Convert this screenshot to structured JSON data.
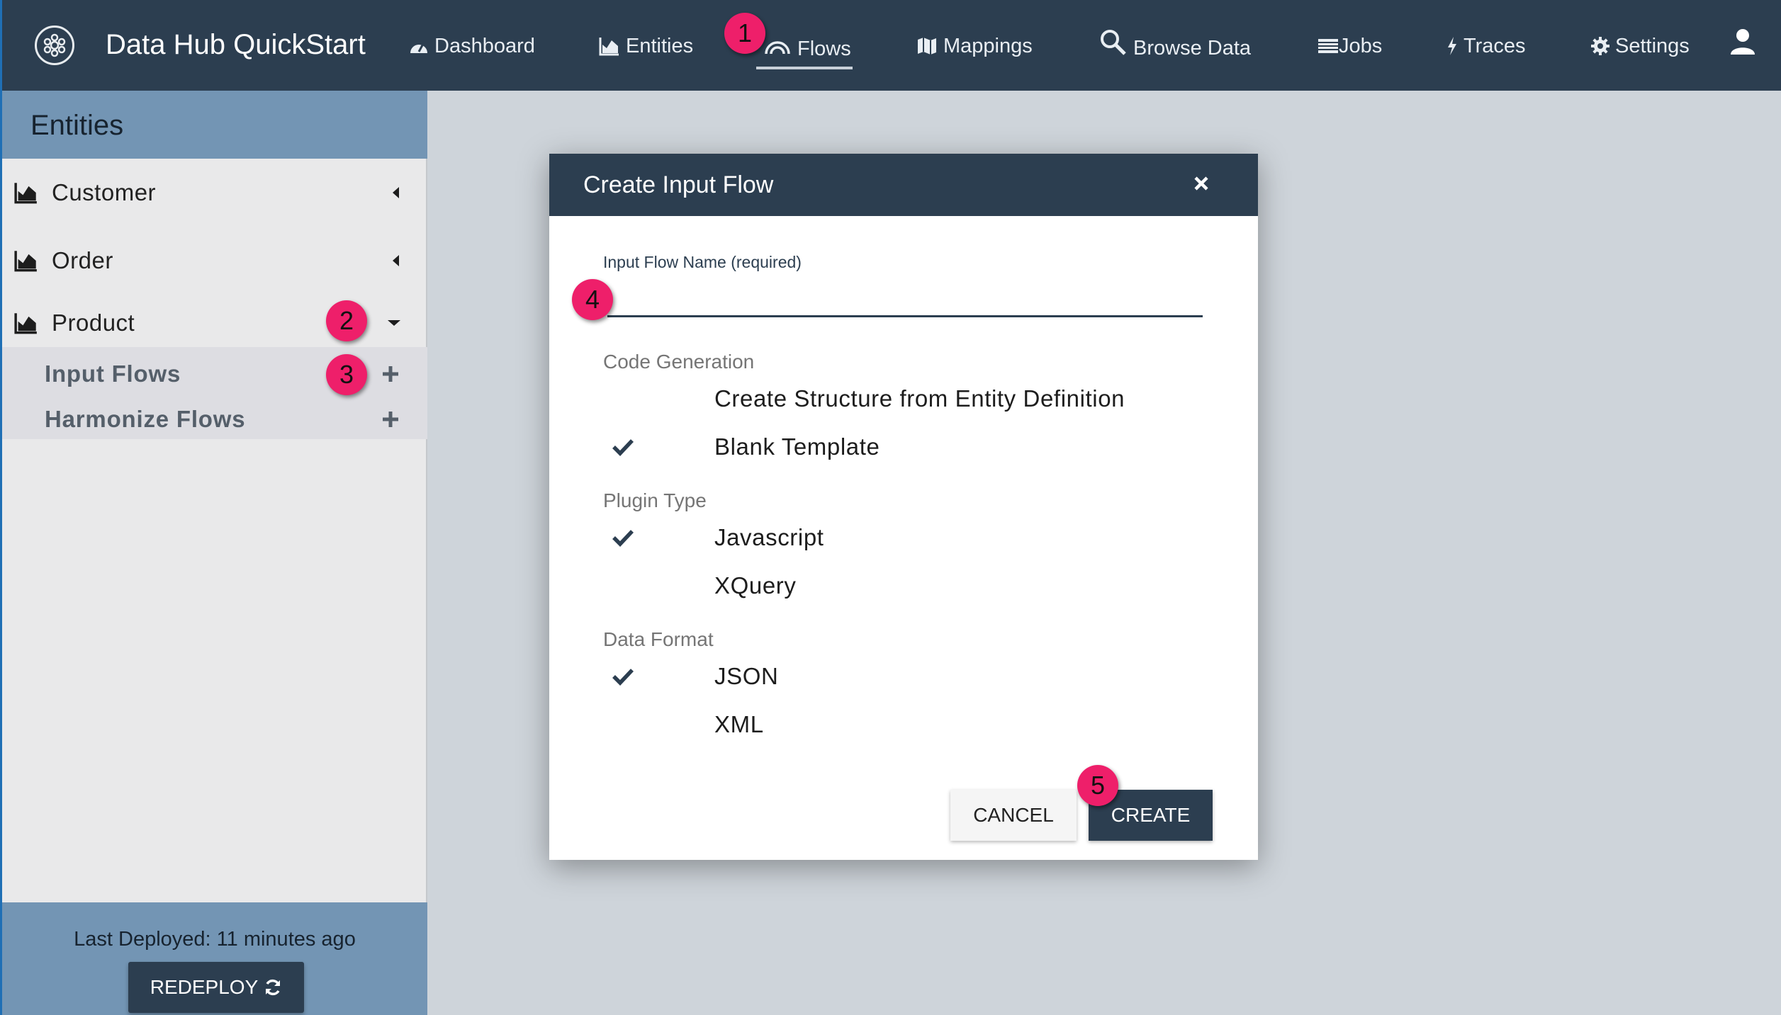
{
  "app": {
    "title": "Data Hub QuickStart",
    "accent_color": "#2c3e50",
    "sidebar_color": "#7395b4",
    "marker_color": "#ee1f6a"
  },
  "nav": {
    "items": [
      {
        "label": "Dashboard",
        "icon": "dashboard-icon"
      },
      {
        "label": "Entities",
        "icon": "area-chart-icon"
      },
      {
        "label": "Flows",
        "icon": "flows-arc-icon",
        "active": true
      },
      {
        "label": "Mappings",
        "icon": "map-icon"
      },
      {
        "label": "Browse Data",
        "icon": "search-icon"
      },
      {
        "label": "Jobs",
        "icon": "list-icon"
      },
      {
        "label": "Traces",
        "icon": "bolt-icon"
      },
      {
        "label": "Settings",
        "icon": "gear-icon"
      }
    ],
    "user_icon": "user-icon"
  },
  "sidebar": {
    "title": "Entities",
    "entities": [
      {
        "label": "Customer",
        "expanded": false
      },
      {
        "label": "Order",
        "expanded": false
      },
      {
        "label": "Product",
        "expanded": true
      }
    ],
    "flows": [
      {
        "label": "Input Flows"
      },
      {
        "label": "Harmonize Flows"
      }
    ],
    "footer": {
      "last_deployed": "Last Deployed: 11 minutes ago",
      "redeploy_label": "REDEPLOY"
    }
  },
  "modal": {
    "title": "Create Input Flow",
    "name_label": "Input Flow Name (required)",
    "name_value": "",
    "sections": {
      "code_generation": {
        "label": "Code Generation",
        "options": [
          {
            "label": "Create Structure from Entity Definition",
            "selected": false
          },
          {
            "label": "Blank Template",
            "selected": true
          }
        ]
      },
      "plugin_type": {
        "label": "Plugin Type",
        "options": [
          {
            "label": "Javascript",
            "selected": true
          },
          {
            "label": "XQuery",
            "selected": false
          }
        ]
      },
      "data_format": {
        "label": "Data Format",
        "options": [
          {
            "label": "JSON",
            "selected": true
          },
          {
            "label": "XML",
            "selected": false
          }
        ]
      }
    },
    "cancel_label": "CANCEL",
    "create_label": "CREATE"
  },
  "markers": [
    "1",
    "2",
    "3",
    "4",
    "5"
  ]
}
